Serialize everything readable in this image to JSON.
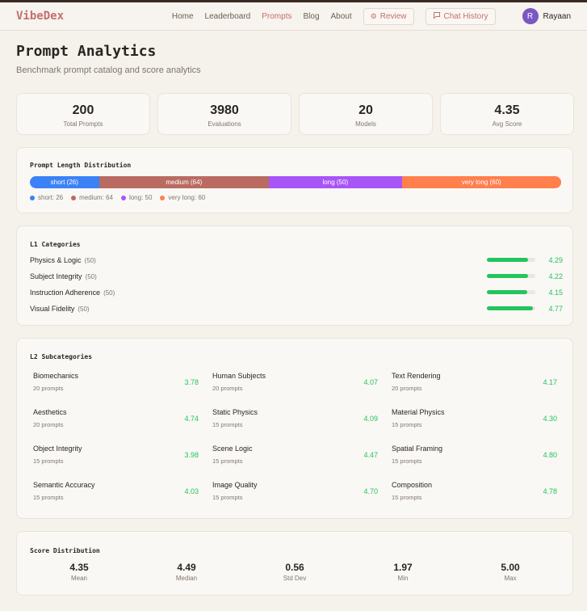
{
  "nav": {
    "brand": "VibeDex",
    "links": [
      "Home",
      "Leaderboard",
      "Prompts",
      "Blog",
      "About"
    ],
    "review_label": "Review",
    "chat_label": "Chat History",
    "user_initial": "R",
    "user_name": "Rayaan"
  },
  "page": {
    "title": "Prompt Analytics",
    "subtitle": "Benchmark prompt catalog and score analytics"
  },
  "stats": [
    {
      "value": "200",
      "label": "Total Prompts"
    },
    {
      "value": "3980",
      "label": "Evaluations"
    },
    {
      "value": "20",
      "label": "Models"
    },
    {
      "value": "4.35",
      "label": "Avg Score"
    }
  ],
  "length": {
    "title": "Prompt Length Distribution",
    "segments": [
      {
        "label": "short (26)",
        "count": 26,
        "color": "#3b82f6",
        "legend": "short: 26"
      },
      {
        "label": "medium (64)",
        "count": 64,
        "color": "#b96b62",
        "legend": "medium: 64"
      },
      {
        "label": "long (50)",
        "count": 50,
        "color": "#a855f7",
        "legend": "long: 50"
      },
      {
        "label": "very long (60)",
        "count": 60,
        "color": "#ff7f4d",
        "legend": "very long: 60"
      }
    ]
  },
  "l1": {
    "title": "L1 Categories",
    "items": [
      {
        "name": "Physics & Logic",
        "count": "(50)",
        "score": "4.29",
        "fill": 0.858
      },
      {
        "name": "Subject Integrity",
        "count": "(50)",
        "score": "4.22",
        "fill": 0.844
      },
      {
        "name": "Instruction Adherence",
        "count": "(50)",
        "score": "4.15",
        "fill": 0.83
      },
      {
        "name": "Visual Fidelity",
        "count": "(50)",
        "score": "4.77",
        "fill": 0.954
      }
    ]
  },
  "l2": {
    "title": "L2 Subcategories",
    "items": [
      {
        "name": "Biomechanics",
        "count": "20 prompts",
        "score": "3.78"
      },
      {
        "name": "Human Subjects",
        "count": "20 prompts",
        "score": "4.07"
      },
      {
        "name": "Text Rendering",
        "count": "20 prompts",
        "score": "4.17"
      },
      {
        "name": "Aesthetics",
        "count": "20 prompts",
        "score": "4.74"
      },
      {
        "name": "Static Physics",
        "count": "15 prompts",
        "score": "4.09"
      },
      {
        "name": "Material Physics",
        "count": "15 prompts",
        "score": "4.30"
      },
      {
        "name": "Object Integrity",
        "count": "15 prompts",
        "score": "3.98"
      },
      {
        "name": "Scene Logic",
        "count": "15 prompts",
        "score": "4.47"
      },
      {
        "name": "Spatial Framing",
        "count": "15 prompts",
        "score": "4.80"
      },
      {
        "name": "Semantic Accuracy",
        "count": "15 prompts",
        "score": "4.03"
      },
      {
        "name": "Image Quality",
        "count": "15 prompts",
        "score": "4.70"
      },
      {
        "name": "Composition",
        "count": "15 prompts",
        "score": "4.78"
      }
    ]
  },
  "dist": {
    "title": "Score Distribution",
    "items": [
      {
        "value": "4.35",
        "label": "Mean"
      },
      {
        "value": "4.49",
        "label": "Median"
      },
      {
        "value": "0.56",
        "label": "Std Dev"
      },
      {
        "value": "1.97",
        "label": "Min"
      },
      {
        "value": "5.00",
        "label": "Max"
      }
    ]
  }
}
